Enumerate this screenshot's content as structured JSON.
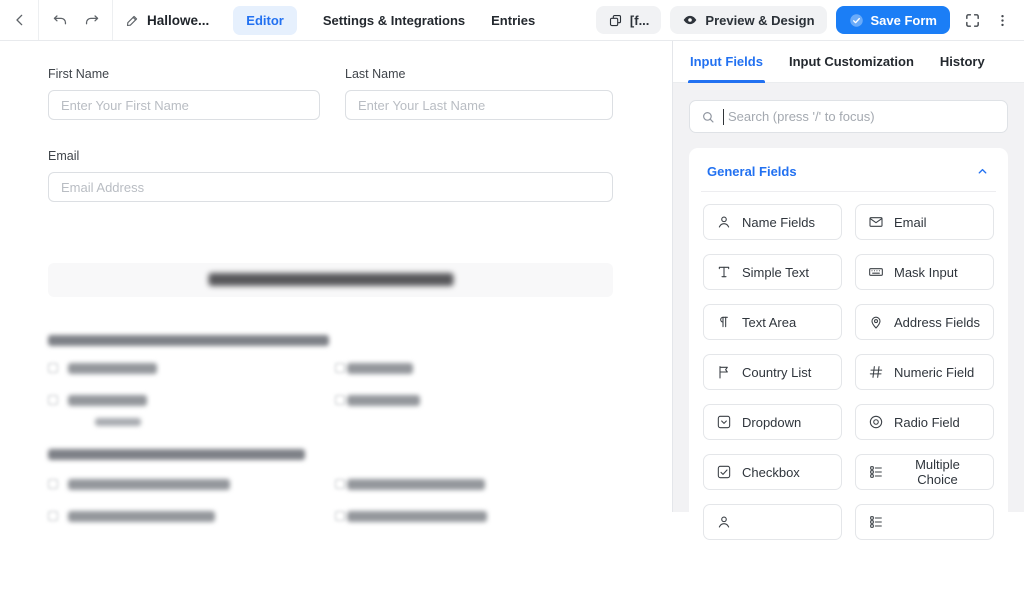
{
  "topbar": {
    "form_title": "Hallowe...",
    "nav_tabs": [
      {
        "label": "Editor",
        "active": true
      },
      {
        "label": "Settings & Integrations",
        "active": false
      },
      {
        "label": "Entries",
        "active": false
      }
    ],
    "shortcode_button_label": "[f...",
    "preview_button_label": "Preview & Design",
    "save_button_label": "Save Form",
    "icons": [
      "back-icon",
      "undo-icon",
      "redo-icon",
      "edit-pencil-icon",
      "copy-icon",
      "eye-icon",
      "check-circle-icon",
      "fullscreen-icon",
      "kebab-menu-icon"
    ]
  },
  "form_editor": {
    "fields": [
      {
        "label": "First Name",
        "placeholder": "Enter Your First Name"
      },
      {
        "label": "Last Name",
        "placeholder": "Enter Your Last Name"
      },
      {
        "label": "Email",
        "placeholder": "Email Address"
      }
    ],
    "redacted_sections": [
      "content-heading",
      "checkbox-question-1",
      "checkbox-question-2"
    ]
  },
  "sidebar": {
    "tabs": [
      {
        "label": "Input Fields",
        "active": true
      },
      {
        "label": "Input Customization",
        "active": false
      },
      {
        "label": "History",
        "active": false
      }
    ],
    "search": {
      "placeholder": "Search (press '/' to focus)",
      "icon": "search-icon"
    },
    "section": {
      "title": "General Fields",
      "collapse_icon": "chevron-up-icon",
      "items": [
        {
          "label": "Name Fields",
          "icon": "user-icon"
        },
        {
          "label": "Email",
          "icon": "envelope-icon"
        },
        {
          "label": "Simple Text",
          "icon": "text-cursor-icon"
        },
        {
          "label": "Mask Input",
          "icon": "keyboard-icon"
        },
        {
          "label": "Text Area",
          "icon": "paragraph-icon"
        },
        {
          "label": "Address Fields",
          "icon": "map-pin-icon"
        },
        {
          "label": "Country List",
          "icon": "flag-icon"
        },
        {
          "label": "Numeric Field",
          "icon": "hash-icon"
        },
        {
          "label": "Dropdown",
          "icon": "dropdown-icon"
        },
        {
          "label": "Radio Field",
          "icon": "radio-icon"
        },
        {
          "label": "Checkbox",
          "icon": "checkbox-icon"
        },
        {
          "label": "Multiple Choice",
          "icon": "list-icon"
        }
      ]
    }
  },
  "colors": {
    "accent": "#2271f1",
    "accent_bg": "#e6f0fd",
    "save_button": "#1b7ef6",
    "sidebar_bg": "#f2f2f4",
    "border": "#e4e6ea"
  }
}
